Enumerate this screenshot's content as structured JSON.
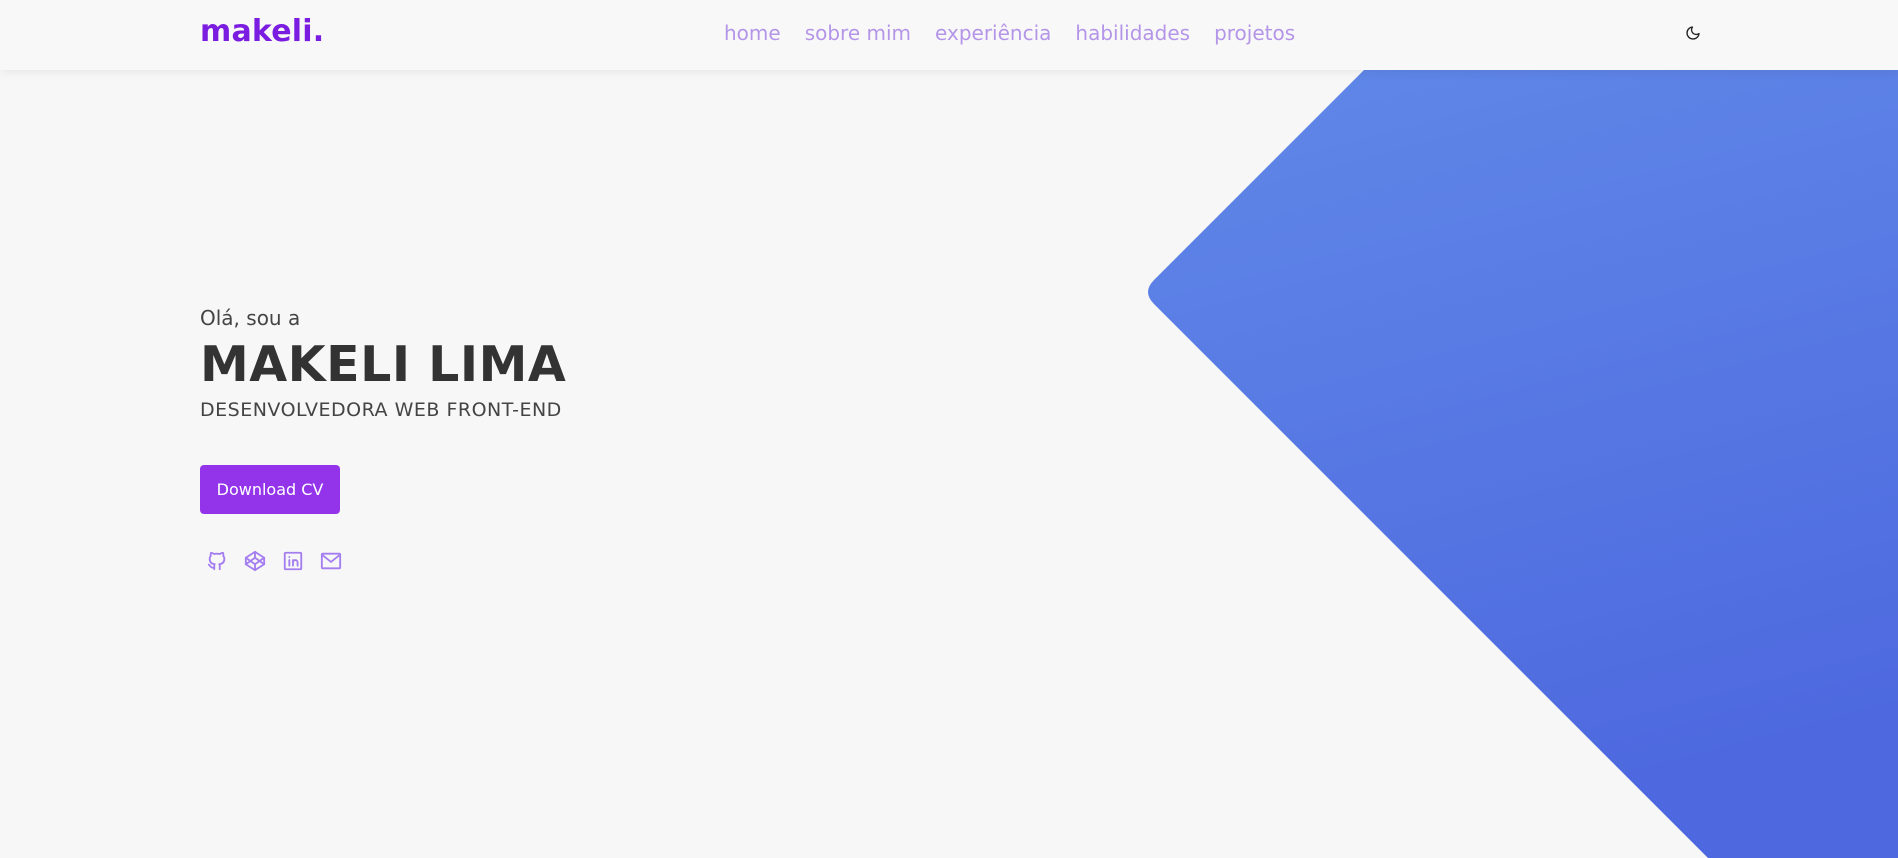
{
  "header": {
    "logo": "makeli.",
    "nav": [
      "home",
      "sobre mim",
      "experiência",
      "habilidades",
      "projetos"
    ],
    "theme_toggle_icon": "moon-icon"
  },
  "hero": {
    "greeting": "Olá, sou a",
    "name": "MAKELI LIMA",
    "role": "DESENVOLVEDORA WEB FRONT-END",
    "cta_label": "Download CV",
    "socials": [
      "github-icon",
      "codepen-icon",
      "linkedin-icon",
      "mail-icon"
    ]
  },
  "colors": {
    "brand": "#7a1de0",
    "nav_link": "#b495e8",
    "button": "#9333ea",
    "shape_top": "#6088e8",
    "shape_bottom": "#4e69df"
  }
}
